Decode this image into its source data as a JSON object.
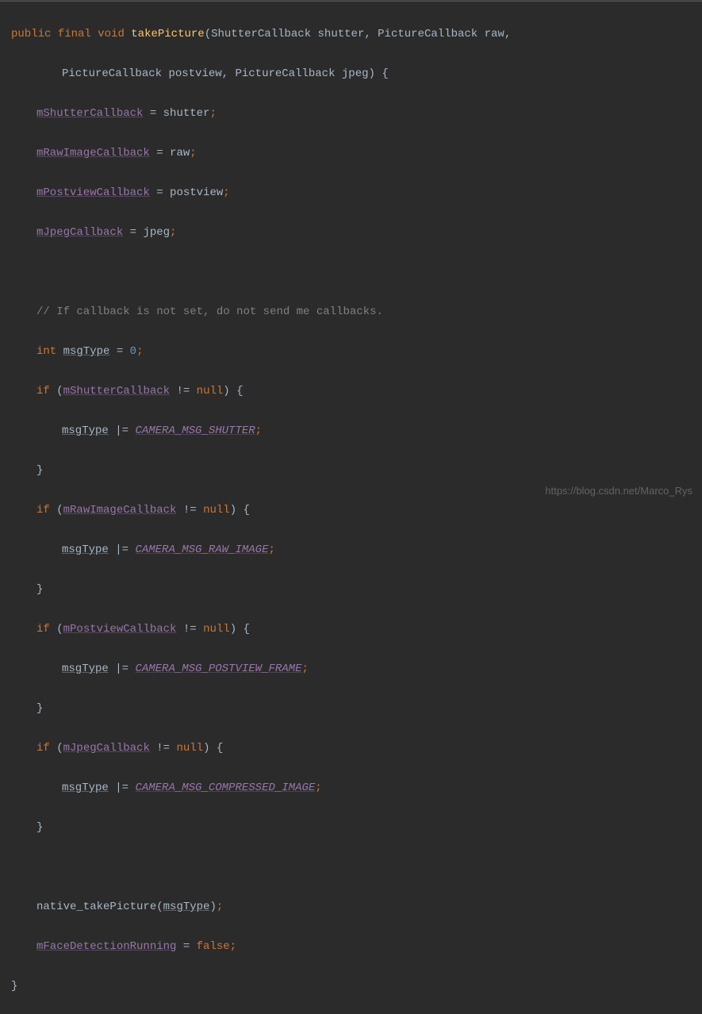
{
  "code": {
    "modifiers": {
      "public": "public",
      "final": "final",
      "void": "void"
    },
    "methodName": "takePicture",
    "params": {
      "p1type": "ShutterCallback",
      "p1name": "shutter",
      "p2type": "PictureCallback",
      "p2name": "raw",
      "p3type": "PictureCallback",
      "p3name": "postview",
      "p4type": "PictureCallback",
      "p4name": "jpeg"
    },
    "assigns": {
      "a1l": "mShutterCallback",
      "a1r": "shutter",
      "a2l": "mRawImageCallback",
      "a2r": "raw",
      "a3l": "mPostviewCallback",
      "a3r": "postview",
      "a4l": "mJpegCallback",
      "a4r": "jpeg"
    },
    "comment": "// If callback is not set, do not send me callbacks.",
    "msgDecl": {
      "int": "int",
      "name": "msgType",
      "eq": "=",
      "val": "0"
    },
    "ifs": {
      "if": "if",
      "cond1": "mShutterCallback",
      "const1": "CAMERA_MSG_SHUTTER",
      "cond2": "mRawImageCallback",
      "const2": "CAMERA_MSG_RAW_IMAGE",
      "cond3": "mPostviewCallback",
      "const3": "CAMERA_MSG_POSTVIEW_FRAME",
      "cond4": "mJpegCallback",
      "const4": "CAMERA_MSG_COMPRESSED_IMAGE",
      "neq": "!=",
      "null": "null",
      "oreq": "|="
    },
    "call": {
      "name": "native_takePicture",
      "arg": "msgType"
    },
    "finalAssign": {
      "l": "mFaceDetectionRunning",
      "r": "false"
    }
  },
  "watermark": "https://blog.csdn.net/Marco_Rys",
  "wmBg": ""
}
